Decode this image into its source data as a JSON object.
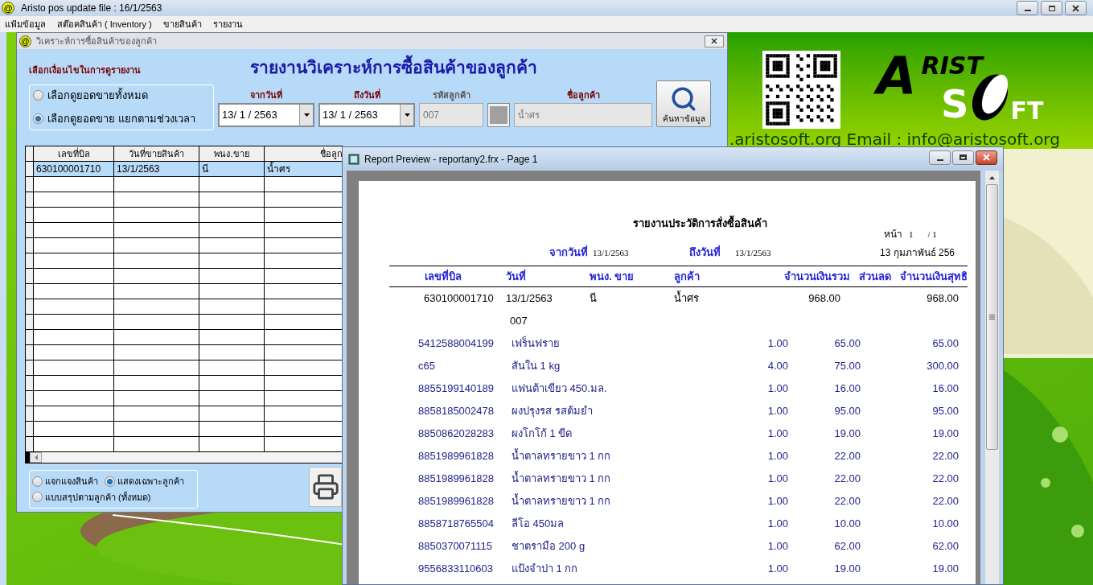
{
  "app": {
    "icon": "@",
    "title": "Aristo pos  update file : 16/1/2563",
    "menu": [
      {
        "label": "แฟ้มข้อมูล"
      },
      {
        "label": "สต๊อคสินค้า ( Inventory )"
      },
      {
        "label": "ขายสินค้า"
      },
      {
        "label": "รายงาน"
      }
    ]
  },
  "analysis_window": {
    "icon": "@",
    "title": "วิเคราะห์การซื้อสินค้าของลูกค้า",
    "options_label": "เลือกเงื่อนไขในการดูรายงาน",
    "heading": "รายงานวิเคราะห์การซื้อสินค้าของลูกค้า",
    "view_options": [
      {
        "label": "เลือกดูยอดขายทั้งหมด",
        "selected": false
      },
      {
        "label": "เลือกดูยอดขาย แยกตามช่วงเวลา",
        "selected": true
      }
    ],
    "filters": {
      "from_date": {
        "label": "จากวันที่",
        "value": "13/ 1 / 2563"
      },
      "to_date": {
        "label": "ถึงวันที่",
        "value": "13/ 1 / 2563"
      },
      "customer_code": {
        "label": "รหัสลูกค้า",
        "value": "007",
        "disabled": true
      },
      "customer_name": {
        "label": "ชื่อลูกค้า",
        "value": "น้ำศร",
        "disabled": true
      }
    },
    "search_button": "ค้นหาข้อมูล",
    "grid": {
      "columns": [
        "เลขที่บิล",
        "วันที่ขายสินค้า",
        "พนง.ขาย",
        "ชื่อลูก"
      ],
      "rows": [
        {
          "cells": [
            "630100001710",
            "13/1/2563",
            "นี",
            "น้ำศร"
          ],
          "selected": true
        }
      ]
    },
    "report_options": [
      {
        "label": "แจกแจงสินค้า",
        "selected": false
      },
      {
        "label": "แสดงเฉพาะลูกค้า",
        "selected": true
      },
      {
        "label": "แบบสรุปตามลูกค้า (ทั้งหมด)",
        "selected": false
      }
    ]
  },
  "banner": {
    "logo": {
      "line_1_first": "A",
      "line_1_rest": "RIST",
      "line_2_left": "S",
      "line_2_right": "FT"
    },
    "contact": ".aristosoft.org   Email : info@aristosoft.org"
  },
  "report_window": {
    "title": "Report Preview - reportany2.frx - Page 1",
    "page": {
      "title": "รายงานประวัติการสั่งซื้อสินค้า",
      "page_label": "หน้า",
      "page_no": "1",
      "page_total": "/ 1",
      "from_label": "จากวันที่",
      "from": "13/1/2563",
      "to_label": "ถึงวันที่",
      "to": "13/1/2563",
      "print_date": "13 กุมภาพันธ์ 256",
      "columns": [
        "เลขที่บิล",
        "วันที่",
        "พนง. ขาย",
        "ลูกค้า",
        "จำนวนเงินรวม",
        "ส่วนลด",
        "จำนวนเงินสุทธิ"
      ],
      "bill": {
        "bill_no": "630100001710",
        "date": "13/1/2563",
        "staff": "นี",
        "customer": "น้ำศร",
        "total": "968.00",
        "net": "968.00",
        "customer_code": "007"
      },
      "items": [
        {
          "code": "5412588004199",
          "name": "เฟร็นฟราย",
          "qty": "1.00",
          "price": "65.00",
          "amount": "65.00"
        },
        {
          "code": "c65",
          "name": "สันใน 1 kg",
          "qty": "4.00",
          "price": "75.00",
          "amount": "300.00"
        },
        {
          "code": "8855199140189",
          "name": "แฟนต้าเขียว 450.มล.",
          "qty": "1.00",
          "price": "16.00",
          "amount": "16.00"
        },
        {
          "code": "8858185002478",
          "name": "ผงปรุงรส รสต้มยำ",
          "qty": "1.00",
          "price": "95.00",
          "amount": "95.00"
        },
        {
          "code": "8850862028283",
          "name": "ผงโกโก้ 1 ขีด",
          "qty": "1.00",
          "price": "19.00",
          "amount": "19.00"
        },
        {
          "code": "8851989961828",
          "name": "น้ำตาลทรายขาว 1 กก",
          "qty": "1.00",
          "price": "22.00",
          "amount": "22.00"
        },
        {
          "code": "8851989961828",
          "name": "น้ำตาลทรายขาว 1 กก",
          "qty": "1.00",
          "price": "22.00",
          "amount": "22.00"
        },
        {
          "code": "8851989961828",
          "name": "น้ำตาลทรายขาว 1 กก",
          "qty": "1.00",
          "price": "22.00",
          "amount": "22.00"
        },
        {
          "code": "8858718765504",
          "name": "ลีโอ 450มล",
          "qty": "1.00",
          "price": "10.00",
          "amount": "10.00"
        },
        {
          "code": "8850370071115",
          "name": "ชาตรามือ 200 g",
          "qty": "1.00",
          "price": "62.00",
          "amount": "62.00"
        },
        {
          "code": "9556833110603",
          "name": "แป้งจำปา 1 กก",
          "qty": "1.00",
          "price": "19.00",
          "amount": "19.00"
        }
      ]
    }
  }
}
